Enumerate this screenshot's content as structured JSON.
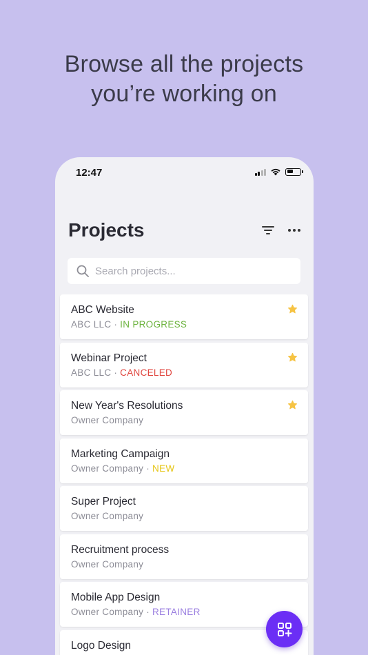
{
  "promo": {
    "line1": "Browse all the projects",
    "line2": "you’re working on"
  },
  "status_bar": {
    "time": "12:47"
  },
  "header": {
    "title": "Projects"
  },
  "search": {
    "placeholder": "Search projects..."
  },
  "projects": [
    {
      "name": "ABC Website",
      "company": "ABC LLC",
      "status": "IN PROGRESS",
      "status_color": "#6db33f",
      "starred": true
    },
    {
      "name": "Webinar Project",
      "company": "ABC LLC",
      "status": "CANCELED",
      "status_color": "#e0463f",
      "starred": true
    },
    {
      "name": "New Year's Resolutions",
      "company": "Owner Company",
      "status": "",
      "status_color": "",
      "starred": true
    },
    {
      "name": "Marketing Campaign",
      "company": "Owner Company",
      "status": "NEW",
      "status_color": "#e6c619",
      "starred": false
    },
    {
      "name": "Super Project",
      "company": "Owner Company",
      "status": "",
      "status_color": "",
      "starred": false
    },
    {
      "name": "Recruitment process",
      "company": "Owner Company",
      "status": "",
      "status_color": "",
      "starred": false
    },
    {
      "name": "Mobile App Design",
      "company": "Owner Company",
      "status": "RETAINER",
      "status_color": "#9b7fe0",
      "starred": false
    },
    {
      "name": "Logo Design",
      "company": "",
      "status": "",
      "status_color": "",
      "starred": false
    }
  ],
  "colors": {
    "background": "#c7c0ee",
    "accent": "#6b2ef5",
    "star": "#f6c343"
  },
  "icons": {
    "filter": "filter-icon",
    "more": "more-icon",
    "search": "search-icon",
    "star": "star-icon",
    "fab": "add-grid-icon"
  }
}
